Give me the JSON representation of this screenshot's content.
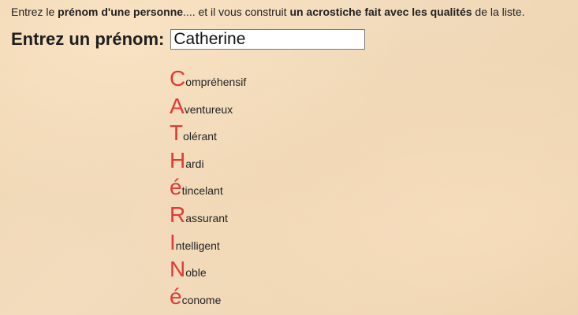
{
  "intro": {
    "t1": "Entrez le ",
    "b1": "prénom d'une personne",
    "t2": ".... et il vous construit ",
    "b2": "un acrostiche fait avec les qualités",
    "t3": " de la liste."
  },
  "prompt": {
    "label": "Entrez un prénom:",
    "value": "Catherine"
  },
  "colors": {
    "initial_letter": "#e03a3a",
    "background": "#efd6b3"
  },
  "acrostic": [
    {
      "initial": "C",
      "rest": "ompréhensif"
    },
    {
      "initial": "A",
      "rest": "venturеux"
    },
    {
      "initial": "T",
      "rest": "olérant"
    },
    {
      "initial": "H",
      "rest": "ardi"
    },
    {
      "initial": "é",
      "rest": "tincelant"
    },
    {
      "initial": "R",
      "rest": "assurant"
    },
    {
      "initial": "I",
      "rest": "ntelligent"
    },
    {
      "initial": "N",
      "rest": "oble"
    },
    {
      "initial": "é",
      "rest": "conome"
    }
  ]
}
